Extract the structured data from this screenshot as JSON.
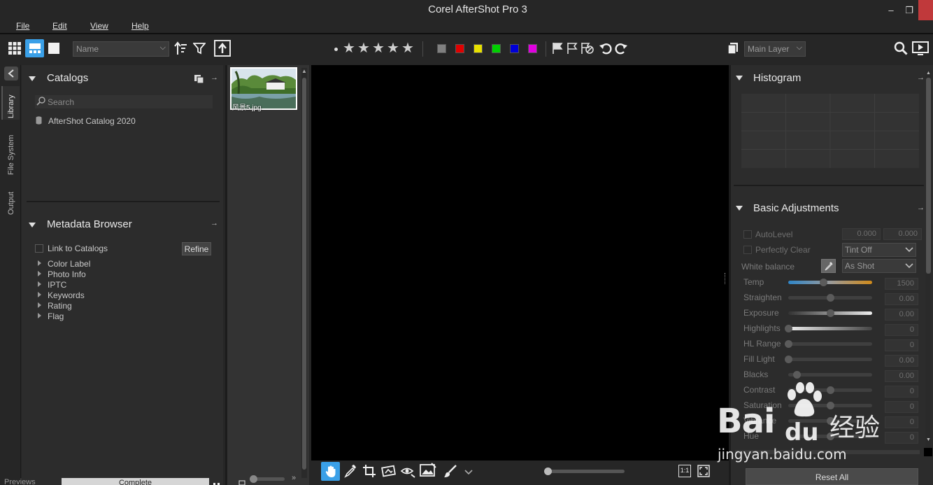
{
  "window": {
    "title": "Corel AfterShot Pro 3"
  },
  "menu": [
    "File",
    "Edit",
    "View",
    "Help"
  ],
  "toolbar": {
    "sort_select": "Name",
    "layer_select": "Main Layer",
    "color_labels": [
      "#808080",
      "#e00000",
      "#e8e000",
      "#00d000",
      "#0000d8",
      "#e000e0"
    ]
  },
  "left_tabs": [
    "Library",
    "File System",
    "Output"
  ],
  "catalogs": {
    "title": "Catalogs",
    "search_placeholder": "Search",
    "items": [
      "AfterShot Catalog 2020"
    ]
  },
  "metadata": {
    "title": "Metadata Browser",
    "link_label": "Link to Catalogs",
    "refine_label": "Refine",
    "items": [
      "Color Label",
      "Photo Info",
      "IPTC",
      "Keywords",
      "Rating",
      "Flag"
    ]
  },
  "filmstrip": {
    "thumb_caption": "风景5.jpg"
  },
  "bottom_left": {
    "previews_label": "Previews",
    "complete_label": "Complete"
  },
  "histogram": {
    "title": "Histogram"
  },
  "basic": {
    "title": "Basic Adjustments",
    "autolevel": {
      "label": "AutoLevel",
      "v1": "0.000",
      "v2": "0.000"
    },
    "perfectly_clear": {
      "label": "Perfectly Clear",
      "select": "Tint Off"
    },
    "white_balance": {
      "label": "White balance",
      "select": "As Shot"
    },
    "sliders": [
      {
        "label": "Temp",
        "value": "1500",
        "pos": 0.42
      },
      {
        "label": "Straighten",
        "value": "0.00",
        "pos": 0.5
      },
      {
        "label": "Exposure",
        "value": "0.00",
        "pos": 0.5
      },
      {
        "label": "Highlights",
        "value": "0",
        "pos": 0.0
      },
      {
        "label": "HL Range",
        "value": "0",
        "pos": 0.0
      },
      {
        "label": "Fill Light",
        "value": "0.00",
        "pos": 0.0
      },
      {
        "label": "Blacks",
        "value": "0.00",
        "pos": 0.1
      },
      {
        "label": "Contrast",
        "value": "0",
        "pos": 0.5
      },
      {
        "label": "Saturation",
        "value": "0",
        "pos": 0.5
      },
      {
        "label": "Vibrance",
        "value": "0",
        "pos": 0.5
      },
      {
        "label": "Hue",
        "value": "0",
        "pos": 0.5
      }
    ],
    "reset_label": "Reset All"
  },
  "watermark": {
    "brand": "Bai",
    "brand2": "du",
    "cn": "经验",
    "url": "jingyan.baidu.com"
  }
}
